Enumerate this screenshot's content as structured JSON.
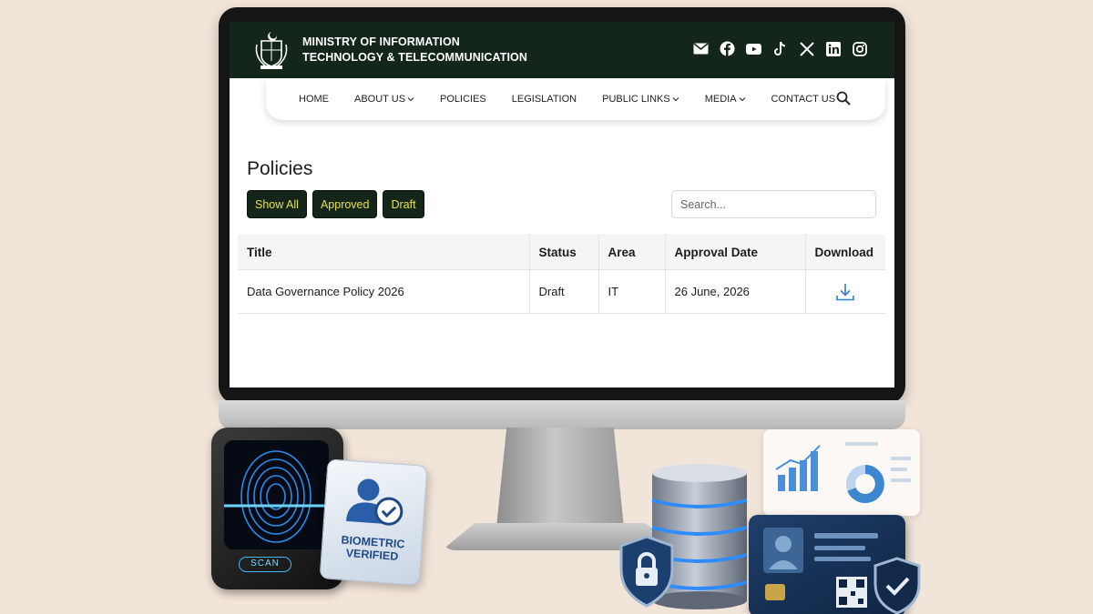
{
  "header": {
    "ministry_line1": "MINISTRY OF INFORMATION",
    "ministry_line2": "TECHNOLOGY & TELECOMMUNICATION",
    "social_icons": [
      "mail-icon",
      "facebook-icon",
      "youtube-icon",
      "tiktok-icon",
      "x-icon",
      "linkedin-icon",
      "instagram-icon"
    ]
  },
  "nav": {
    "items": [
      {
        "label": "HOME",
        "dropdown": false
      },
      {
        "label": "ABOUT US",
        "dropdown": true
      },
      {
        "label": "POLICIES",
        "dropdown": false
      },
      {
        "label": "LEGISLATION",
        "dropdown": false
      },
      {
        "label": "PUBLIC LINKS",
        "dropdown": true
      },
      {
        "label": "MEDIA",
        "dropdown": true
      },
      {
        "label": "CONTACT US",
        "dropdown": false
      }
    ]
  },
  "page": {
    "title": "Policies",
    "filters": [
      "Show All",
      "Approved",
      "Draft"
    ],
    "search_placeholder": "Search..."
  },
  "table": {
    "columns": [
      "Title",
      "Status",
      "Area",
      "Approval Date",
      "Download"
    ],
    "rows": [
      {
        "title": "Data Governance Policy 2026",
        "status": "Draft",
        "area": "IT",
        "approval_date": "26 June, 2026"
      }
    ]
  },
  "illustrations": {
    "scan_label": "SCAN",
    "bio_line1": "BIOMETRIC",
    "bio_line2": "VERIFIED"
  },
  "colors": {
    "header_bg": "#14251a",
    "filter_text": "#e9e23a",
    "download_icon": "#2f7fd6",
    "background": "#f1e4d8"
  }
}
